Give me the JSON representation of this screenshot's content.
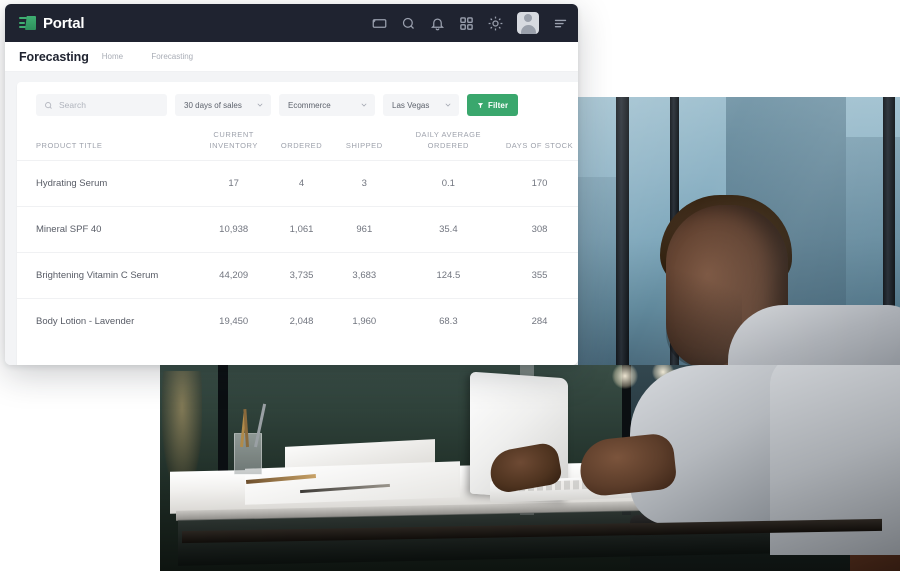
{
  "topbar": {
    "brand_name": "Portal",
    "logo_icon": "speed-block-logo-icon",
    "icons": [
      {
        "name": "screen-icon",
        "glyph": "screen"
      },
      {
        "name": "search-icon",
        "glyph": "search"
      },
      {
        "name": "bell-icon",
        "glyph": "bell"
      },
      {
        "name": "apps-grid-icon",
        "glyph": "grid"
      },
      {
        "name": "brightness-icon",
        "glyph": "sun"
      }
    ],
    "avatar_label": "avatar",
    "menu_icon": "menu-icon",
    "bg_color": "#1f2330"
  },
  "breadcrumb": {
    "page_title": "Forecasting",
    "items": [
      "Home",
      "Forecasting"
    ],
    "separator": ""
  },
  "controls": {
    "search": {
      "placeholder": "Search",
      "value": ""
    },
    "selects": [
      {
        "name": "date-range-select",
        "value": "30 days of sales"
      },
      {
        "name": "channel-select",
        "value": "Ecommerce"
      },
      {
        "name": "location-select",
        "value": "Las Vegas"
      }
    ],
    "filter_button": {
      "label": "Filter",
      "icon": "funnel-icon",
      "color": "#3aa76d"
    }
  },
  "table": {
    "columns": [
      {
        "key": "product_title",
        "label": "PRODUCT TITLE"
      },
      {
        "key": "current_inventory",
        "label": "CURRENT INVENTORY"
      },
      {
        "key": "ordered",
        "label": "ORDERED"
      },
      {
        "key": "shipped",
        "label": "SHIPPED"
      },
      {
        "key": "daily_average",
        "label": "DAILY AVERAGE ORDERED"
      },
      {
        "key": "days_of_stock",
        "label": "DAYS OF STOCK"
      }
    ],
    "rows": [
      {
        "product_title": "Hydrating Serum",
        "current_inventory": "17",
        "ordered": "4",
        "shipped": "3",
        "daily_average": "0.1",
        "days_of_stock": "170"
      },
      {
        "product_title": "Mineral SPF 40",
        "current_inventory": "10,938",
        "ordered": "1,061",
        "shipped": "961",
        "daily_average": "35.4",
        "days_of_stock": "308"
      },
      {
        "product_title": "Brightening Vitamin C Serum",
        "current_inventory": "44,209",
        "ordered": "3,735",
        "shipped": "3,683",
        "daily_average": "124.5",
        "days_of_stock": "355"
      },
      {
        "product_title": "Body Lotion - Lavender",
        "current_inventory": "19,450",
        "ordered": "2,048",
        "shipped": "1,960",
        "daily_average": "68.3",
        "days_of_stock": "284"
      }
    ]
  },
  "photo": {
    "description": "Man working on a laptop at an office desk by a window"
  }
}
